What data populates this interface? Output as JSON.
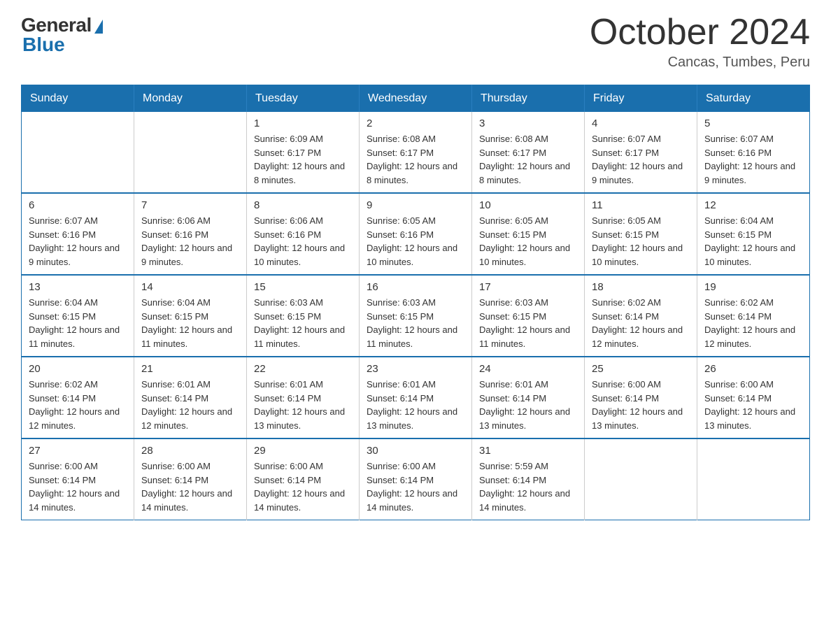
{
  "logo": {
    "general": "General",
    "blue": "Blue"
  },
  "title": "October 2024",
  "location": "Cancas, Tumbes, Peru",
  "days_of_week": [
    "Sunday",
    "Monday",
    "Tuesday",
    "Wednesday",
    "Thursday",
    "Friday",
    "Saturday"
  ],
  "weeks": [
    [
      {
        "day": "",
        "info": ""
      },
      {
        "day": "",
        "info": ""
      },
      {
        "day": "1",
        "info": "Sunrise: 6:09 AM\nSunset: 6:17 PM\nDaylight: 12 hours and 8 minutes."
      },
      {
        "day": "2",
        "info": "Sunrise: 6:08 AM\nSunset: 6:17 PM\nDaylight: 12 hours and 8 minutes."
      },
      {
        "day": "3",
        "info": "Sunrise: 6:08 AM\nSunset: 6:17 PM\nDaylight: 12 hours and 8 minutes."
      },
      {
        "day": "4",
        "info": "Sunrise: 6:07 AM\nSunset: 6:17 PM\nDaylight: 12 hours and 9 minutes."
      },
      {
        "day": "5",
        "info": "Sunrise: 6:07 AM\nSunset: 6:16 PM\nDaylight: 12 hours and 9 minutes."
      }
    ],
    [
      {
        "day": "6",
        "info": "Sunrise: 6:07 AM\nSunset: 6:16 PM\nDaylight: 12 hours and 9 minutes."
      },
      {
        "day": "7",
        "info": "Sunrise: 6:06 AM\nSunset: 6:16 PM\nDaylight: 12 hours and 9 minutes."
      },
      {
        "day": "8",
        "info": "Sunrise: 6:06 AM\nSunset: 6:16 PM\nDaylight: 12 hours and 10 minutes."
      },
      {
        "day": "9",
        "info": "Sunrise: 6:05 AM\nSunset: 6:16 PM\nDaylight: 12 hours and 10 minutes."
      },
      {
        "day": "10",
        "info": "Sunrise: 6:05 AM\nSunset: 6:15 PM\nDaylight: 12 hours and 10 minutes."
      },
      {
        "day": "11",
        "info": "Sunrise: 6:05 AM\nSunset: 6:15 PM\nDaylight: 12 hours and 10 minutes."
      },
      {
        "day": "12",
        "info": "Sunrise: 6:04 AM\nSunset: 6:15 PM\nDaylight: 12 hours and 10 minutes."
      }
    ],
    [
      {
        "day": "13",
        "info": "Sunrise: 6:04 AM\nSunset: 6:15 PM\nDaylight: 12 hours and 11 minutes."
      },
      {
        "day": "14",
        "info": "Sunrise: 6:04 AM\nSunset: 6:15 PM\nDaylight: 12 hours and 11 minutes."
      },
      {
        "day": "15",
        "info": "Sunrise: 6:03 AM\nSunset: 6:15 PM\nDaylight: 12 hours and 11 minutes."
      },
      {
        "day": "16",
        "info": "Sunrise: 6:03 AM\nSunset: 6:15 PM\nDaylight: 12 hours and 11 minutes."
      },
      {
        "day": "17",
        "info": "Sunrise: 6:03 AM\nSunset: 6:15 PM\nDaylight: 12 hours and 11 minutes."
      },
      {
        "day": "18",
        "info": "Sunrise: 6:02 AM\nSunset: 6:14 PM\nDaylight: 12 hours and 12 minutes."
      },
      {
        "day": "19",
        "info": "Sunrise: 6:02 AM\nSunset: 6:14 PM\nDaylight: 12 hours and 12 minutes."
      }
    ],
    [
      {
        "day": "20",
        "info": "Sunrise: 6:02 AM\nSunset: 6:14 PM\nDaylight: 12 hours and 12 minutes."
      },
      {
        "day": "21",
        "info": "Sunrise: 6:01 AM\nSunset: 6:14 PM\nDaylight: 12 hours and 12 minutes."
      },
      {
        "day": "22",
        "info": "Sunrise: 6:01 AM\nSunset: 6:14 PM\nDaylight: 12 hours and 13 minutes."
      },
      {
        "day": "23",
        "info": "Sunrise: 6:01 AM\nSunset: 6:14 PM\nDaylight: 12 hours and 13 minutes."
      },
      {
        "day": "24",
        "info": "Sunrise: 6:01 AM\nSunset: 6:14 PM\nDaylight: 12 hours and 13 minutes."
      },
      {
        "day": "25",
        "info": "Sunrise: 6:00 AM\nSunset: 6:14 PM\nDaylight: 12 hours and 13 minutes."
      },
      {
        "day": "26",
        "info": "Sunrise: 6:00 AM\nSunset: 6:14 PM\nDaylight: 12 hours and 13 minutes."
      }
    ],
    [
      {
        "day": "27",
        "info": "Sunrise: 6:00 AM\nSunset: 6:14 PM\nDaylight: 12 hours and 14 minutes."
      },
      {
        "day": "28",
        "info": "Sunrise: 6:00 AM\nSunset: 6:14 PM\nDaylight: 12 hours and 14 minutes."
      },
      {
        "day": "29",
        "info": "Sunrise: 6:00 AM\nSunset: 6:14 PM\nDaylight: 12 hours and 14 minutes."
      },
      {
        "day": "30",
        "info": "Sunrise: 6:00 AM\nSunset: 6:14 PM\nDaylight: 12 hours and 14 minutes."
      },
      {
        "day": "31",
        "info": "Sunrise: 5:59 AM\nSunset: 6:14 PM\nDaylight: 12 hours and 14 minutes."
      },
      {
        "day": "",
        "info": ""
      },
      {
        "day": "",
        "info": ""
      }
    ]
  ]
}
